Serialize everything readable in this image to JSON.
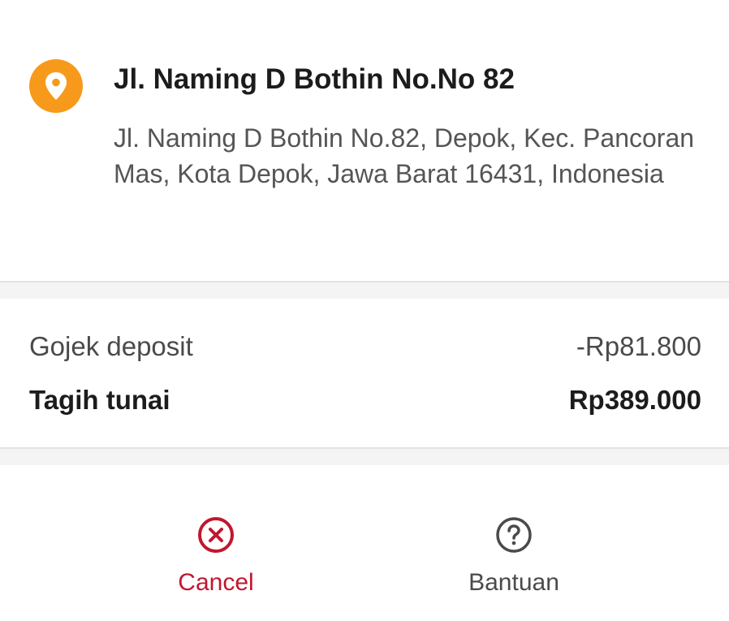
{
  "address": {
    "icon": "location-pin-icon",
    "title": "Jl. Naming D Bothin No.No 82",
    "detail": "Jl. Naming D Bothin No.82, Depok, Kec. Pancoran Mas, Kota Depok, Jawa Barat 16431, Indonesia"
  },
  "payment": {
    "deposit_label": "Gojek deposit",
    "deposit_value": "-Rp81.800",
    "cash_label": "Tagih tunai",
    "cash_value": "Rp389.000"
  },
  "actions": {
    "cancel": {
      "label": "Cancel",
      "icon": "cancel-circle-icon"
    },
    "help": {
      "label": "Bantuan",
      "icon": "help-circle-icon"
    }
  },
  "colors": {
    "pin_badge": "#f79a1b",
    "cancel": "#c0182f",
    "text_primary": "#1c1c1c",
    "text_secondary": "#555555",
    "separator": "#f4f4f4"
  }
}
